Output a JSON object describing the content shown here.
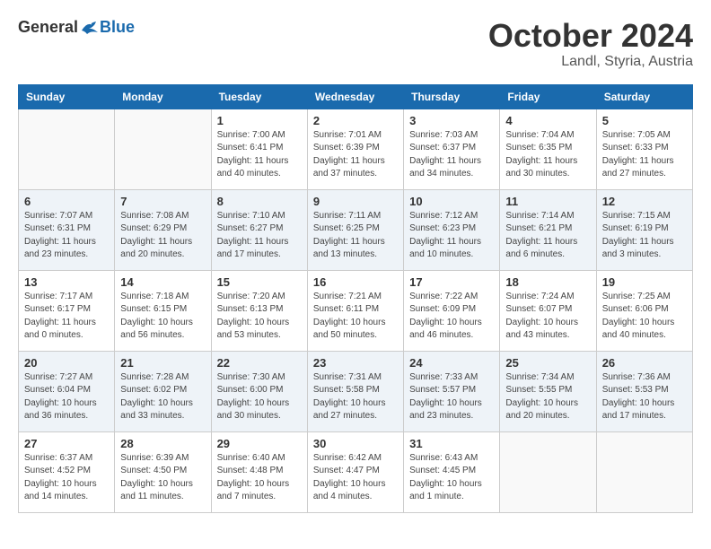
{
  "header": {
    "logo": {
      "general": "General",
      "blue": "Blue"
    },
    "title": "October 2024",
    "location": "Landl, Styria, Austria"
  },
  "calendar": {
    "days_of_week": [
      "Sunday",
      "Monday",
      "Tuesday",
      "Wednesday",
      "Thursday",
      "Friday",
      "Saturday"
    ],
    "weeks": [
      [
        {
          "day": "",
          "info": ""
        },
        {
          "day": "",
          "info": ""
        },
        {
          "day": "1",
          "info": "Sunrise: 7:00 AM\nSunset: 6:41 PM\nDaylight: 11 hours\nand 40 minutes."
        },
        {
          "day": "2",
          "info": "Sunrise: 7:01 AM\nSunset: 6:39 PM\nDaylight: 11 hours\nand 37 minutes."
        },
        {
          "day": "3",
          "info": "Sunrise: 7:03 AM\nSunset: 6:37 PM\nDaylight: 11 hours\nand 34 minutes."
        },
        {
          "day": "4",
          "info": "Sunrise: 7:04 AM\nSunset: 6:35 PM\nDaylight: 11 hours\nand 30 minutes."
        },
        {
          "day": "5",
          "info": "Sunrise: 7:05 AM\nSunset: 6:33 PM\nDaylight: 11 hours\nand 27 minutes."
        }
      ],
      [
        {
          "day": "6",
          "info": "Sunrise: 7:07 AM\nSunset: 6:31 PM\nDaylight: 11 hours\nand 23 minutes."
        },
        {
          "day": "7",
          "info": "Sunrise: 7:08 AM\nSunset: 6:29 PM\nDaylight: 11 hours\nand 20 minutes."
        },
        {
          "day": "8",
          "info": "Sunrise: 7:10 AM\nSunset: 6:27 PM\nDaylight: 11 hours\nand 17 minutes."
        },
        {
          "day": "9",
          "info": "Sunrise: 7:11 AM\nSunset: 6:25 PM\nDaylight: 11 hours\nand 13 minutes."
        },
        {
          "day": "10",
          "info": "Sunrise: 7:12 AM\nSunset: 6:23 PM\nDaylight: 11 hours\nand 10 minutes."
        },
        {
          "day": "11",
          "info": "Sunrise: 7:14 AM\nSunset: 6:21 PM\nDaylight: 11 hours\nand 6 minutes."
        },
        {
          "day": "12",
          "info": "Sunrise: 7:15 AM\nSunset: 6:19 PM\nDaylight: 11 hours\nand 3 minutes."
        }
      ],
      [
        {
          "day": "13",
          "info": "Sunrise: 7:17 AM\nSunset: 6:17 PM\nDaylight: 11 hours\nand 0 minutes."
        },
        {
          "day": "14",
          "info": "Sunrise: 7:18 AM\nSunset: 6:15 PM\nDaylight: 10 hours\nand 56 minutes."
        },
        {
          "day": "15",
          "info": "Sunrise: 7:20 AM\nSunset: 6:13 PM\nDaylight: 10 hours\nand 53 minutes."
        },
        {
          "day": "16",
          "info": "Sunrise: 7:21 AM\nSunset: 6:11 PM\nDaylight: 10 hours\nand 50 minutes."
        },
        {
          "day": "17",
          "info": "Sunrise: 7:22 AM\nSunset: 6:09 PM\nDaylight: 10 hours\nand 46 minutes."
        },
        {
          "day": "18",
          "info": "Sunrise: 7:24 AM\nSunset: 6:07 PM\nDaylight: 10 hours\nand 43 minutes."
        },
        {
          "day": "19",
          "info": "Sunrise: 7:25 AM\nSunset: 6:06 PM\nDaylight: 10 hours\nand 40 minutes."
        }
      ],
      [
        {
          "day": "20",
          "info": "Sunrise: 7:27 AM\nSunset: 6:04 PM\nDaylight: 10 hours\nand 36 minutes."
        },
        {
          "day": "21",
          "info": "Sunrise: 7:28 AM\nSunset: 6:02 PM\nDaylight: 10 hours\nand 33 minutes."
        },
        {
          "day": "22",
          "info": "Sunrise: 7:30 AM\nSunset: 6:00 PM\nDaylight: 10 hours\nand 30 minutes."
        },
        {
          "day": "23",
          "info": "Sunrise: 7:31 AM\nSunset: 5:58 PM\nDaylight: 10 hours\nand 27 minutes."
        },
        {
          "day": "24",
          "info": "Sunrise: 7:33 AM\nSunset: 5:57 PM\nDaylight: 10 hours\nand 23 minutes."
        },
        {
          "day": "25",
          "info": "Sunrise: 7:34 AM\nSunset: 5:55 PM\nDaylight: 10 hours\nand 20 minutes."
        },
        {
          "day": "26",
          "info": "Sunrise: 7:36 AM\nSunset: 5:53 PM\nDaylight: 10 hours\nand 17 minutes."
        }
      ],
      [
        {
          "day": "27",
          "info": "Sunrise: 6:37 AM\nSunset: 4:52 PM\nDaylight: 10 hours\nand 14 minutes."
        },
        {
          "day": "28",
          "info": "Sunrise: 6:39 AM\nSunset: 4:50 PM\nDaylight: 10 hours\nand 11 minutes."
        },
        {
          "day": "29",
          "info": "Sunrise: 6:40 AM\nSunset: 4:48 PM\nDaylight: 10 hours\nand 7 minutes."
        },
        {
          "day": "30",
          "info": "Sunrise: 6:42 AM\nSunset: 4:47 PM\nDaylight: 10 hours\nand 4 minutes."
        },
        {
          "day": "31",
          "info": "Sunrise: 6:43 AM\nSunset: 4:45 PM\nDaylight: 10 hours\nand 1 minute."
        },
        {
          "day": "",
          "info": ""
        },
        {
          "day": "",
          "info": ""
        }
      ]
    ]
  }
}
